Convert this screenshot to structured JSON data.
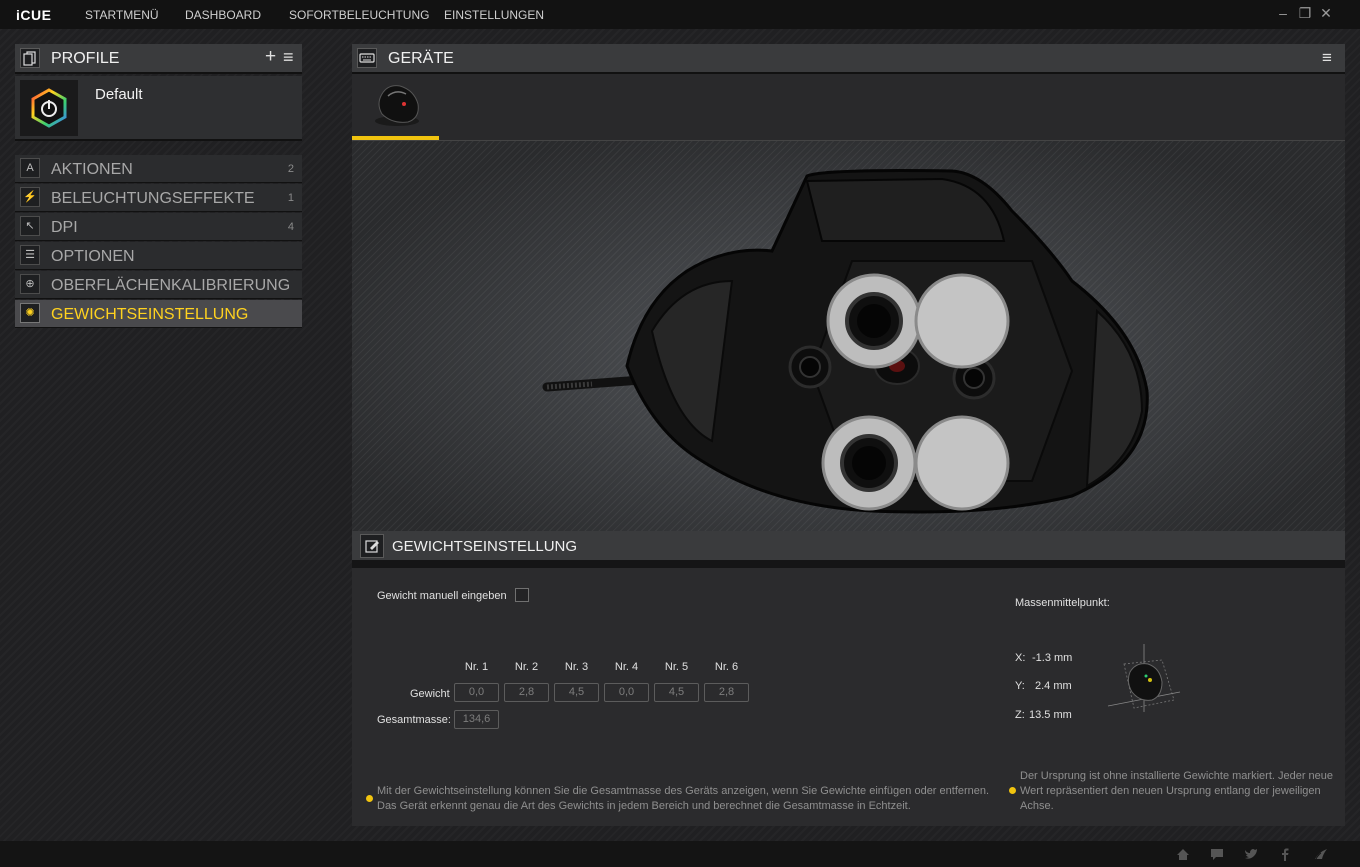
{
  "app": {
    "logo": "iCUE"
  },
  "nav": {
    "items": [
      "STARTMENÜ",
      "DASHBOARD",
      "SOFORTBELEUCHTUNG",
      "EINSTELLUNGEN"
    ]
  },
  "window": {
    "minimize": "–",
    "restore": "❐",
    "close": "✕"
  },
  "profiles": {
    "title": "PROFILE",
    "add": "+",
    "menu": "≡",
    "current": "Default"
  },
  "sidebar": {
    "items": [
      {
        "label": "AKTIONEN",
        "count": "2",
        "icon": "A"
      },
      {
        "label": "BELEUCHTUNGSEFFEKTE",
        "count": "1",
        "icon": "⚡"
      },
      {
        "label": "DPI",
        "count": "4",
        "icon": "↖"
      },
      {
        "label": "OPTIONEN",
        "count": "",
        "icon": "☰"
      },
      {
        "label": "OBERFLÄCHENKALIBRIERUNG",
        "count": "",
        "icon": "⊕"
      },
      {
        "label": "GEWICHTSEINSTELLUNG",
        "count": "",
        "icon": "✺"
      }
    ],
    "active_index": 5
  },
  "devices": {
    "title": "GERÄTE",
    "menu": "≡"
  },
  "weight": {
    "title": "GEWICHTSEINSTELLUNG",
    "manual_label": "Gewicht manuell eingeben",
    "columns": [
      "Nr. 1",
      "Nr. 2",
      "Nr. 3",
      "Nr. 4",
      "Nr. 5",
      "Nr. 6"
    ],
    "row_label": "Gewicht",
    "values": [
      "0,0",
      "2,8",
      "4,5",
      "0,0",
      "4,5",
      "2,8"
    ],
    "total_label": "Gesamtmasse:",
    "total_value": "134,6",
    "center_title": "Massenmittelpunkt:",
    "x_label": "X:",
    "x_value": "-1.3 mm",
    "y_label": "Y:",
    "y_value": "2.4 mm",
    "z_label": "Z:",
    "z_value": "13.5 mm",
    "note_left_1": "Mit der Gewichtseinstellung können Sie die Gesamtmasse des Geräts anzeigen, wenn Sie Gewichte einfügen oder entfernen.",
    "note_left_2": "Das Gerät erkennt genau die Art des Gewichts in jedem Bereich und berechnet die Gesamtmasse in Echtzeit.",
    "note_right_1": "Der Ursprung ist ohne installierte Gewichte markiert. Jeder neue",
    "note_right_2": "Wert repräsentiert den neuen Ursprung entlang der jeweiligen",
    "note_right_3": "Achse."
  },
  "colors": {
    "accent": "#f1c40f",
    "active_text": "#ffd21f"
  }
}
